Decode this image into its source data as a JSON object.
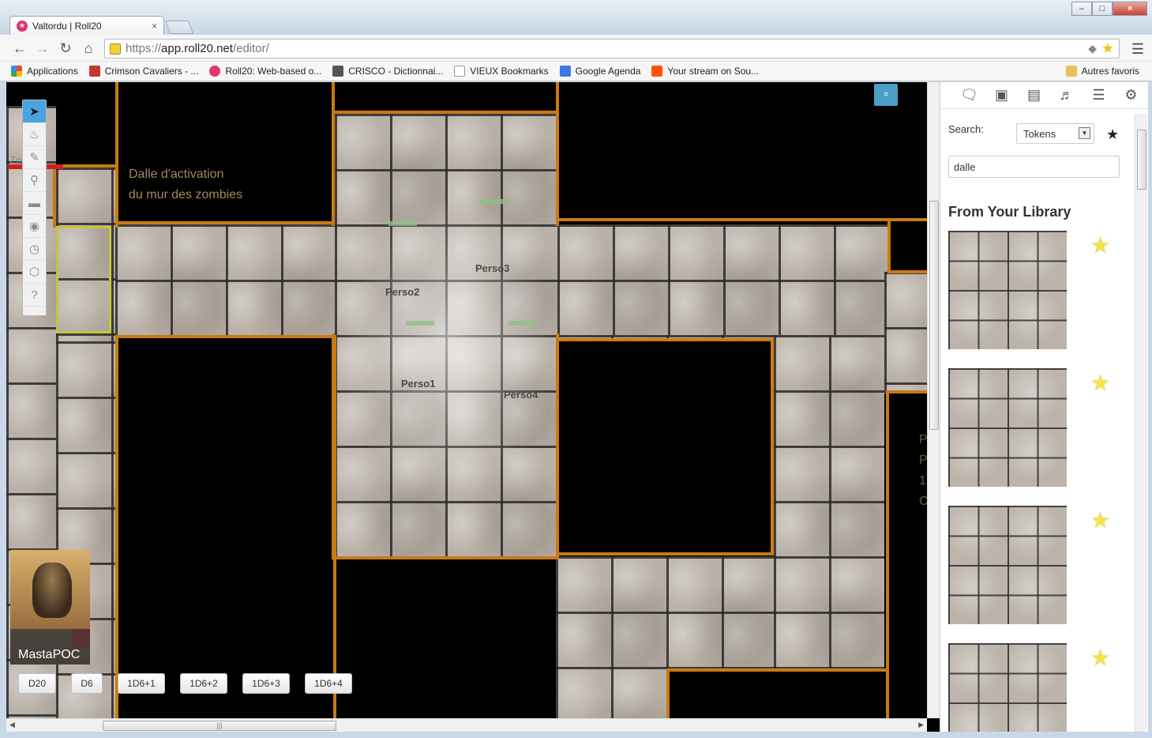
{
  "browser": {
    "tab_title": "Valtordu | Roll20",
    "url_scheme": "https://",
    "url_host": "app.roll20.net",
    "url_path": "/editor/",
    "bookmarks": [
      {
        "label": "Applications",
        "icon": "apps-grid-icon",
        "color": "#4285f4"
      },
      {
        "label": "Crimson Cavaliers - ...",
        "icon": "crimson-icon",
        "color": "#c0392b"
      },
      {
        "label": "Roll20: Web-based o...",
        "icon": "roll20-icon",
        "color": "#e0356e"
      },
      {
        "label": "CRISCO - Dictionnai...",
        "icon": "crisco-icon",
        "color": "#333333"
      },
      {
        "label": "VIEUX Bookmarks",
        "icon": "page-icon",
        "color": "#dddddd"
      },
      {
        "label": "Google Agenda",
        "icon": "calendar-icon",
        "color": "#3b78e7"
      },
      {
        "label": "Your stream on Sou...",
        "icon": "soundcloud-icon",
        "color": "#ff5500"
      }
    ],
    "other_bookmarks": "Autres favoris"
  },
  "map": {
    "note_line1": "Dalle d'activation",
    "note_line2": "du mur des zombies",
    "tokens": [
      {
        "label": "Perso3"
      },
      {
        "label": "Perso2"
      },
      {
        "label": "Perso1"
      },
      {
        "label": "Perso4"
      }
    ],
    "edge_text": [
      "P",
      "P",
      "1",
      "C"
    ],
    "corner_text": "Zo"
  },
  "player": {
    "name": "MastaPOC",
    "color": "#ff0000"
  },
  "macros": [
    "D20",
    "D6",
    "1D6+1",
    "1D6+2",
    "1D6+3",
    "1D6+4"
  ],
  "sidebar": {
    "search_label": "Search:",
    "search_type": "Tokens",
    "search_value": "dalle",
    "library_title": "From Your Library",
    "library_items": 4
  },
  "colors": {
    "wall": "#c97a12",
    "tool_active": "#4aa3df",
    "star": "#f3e34a"
  }
}
